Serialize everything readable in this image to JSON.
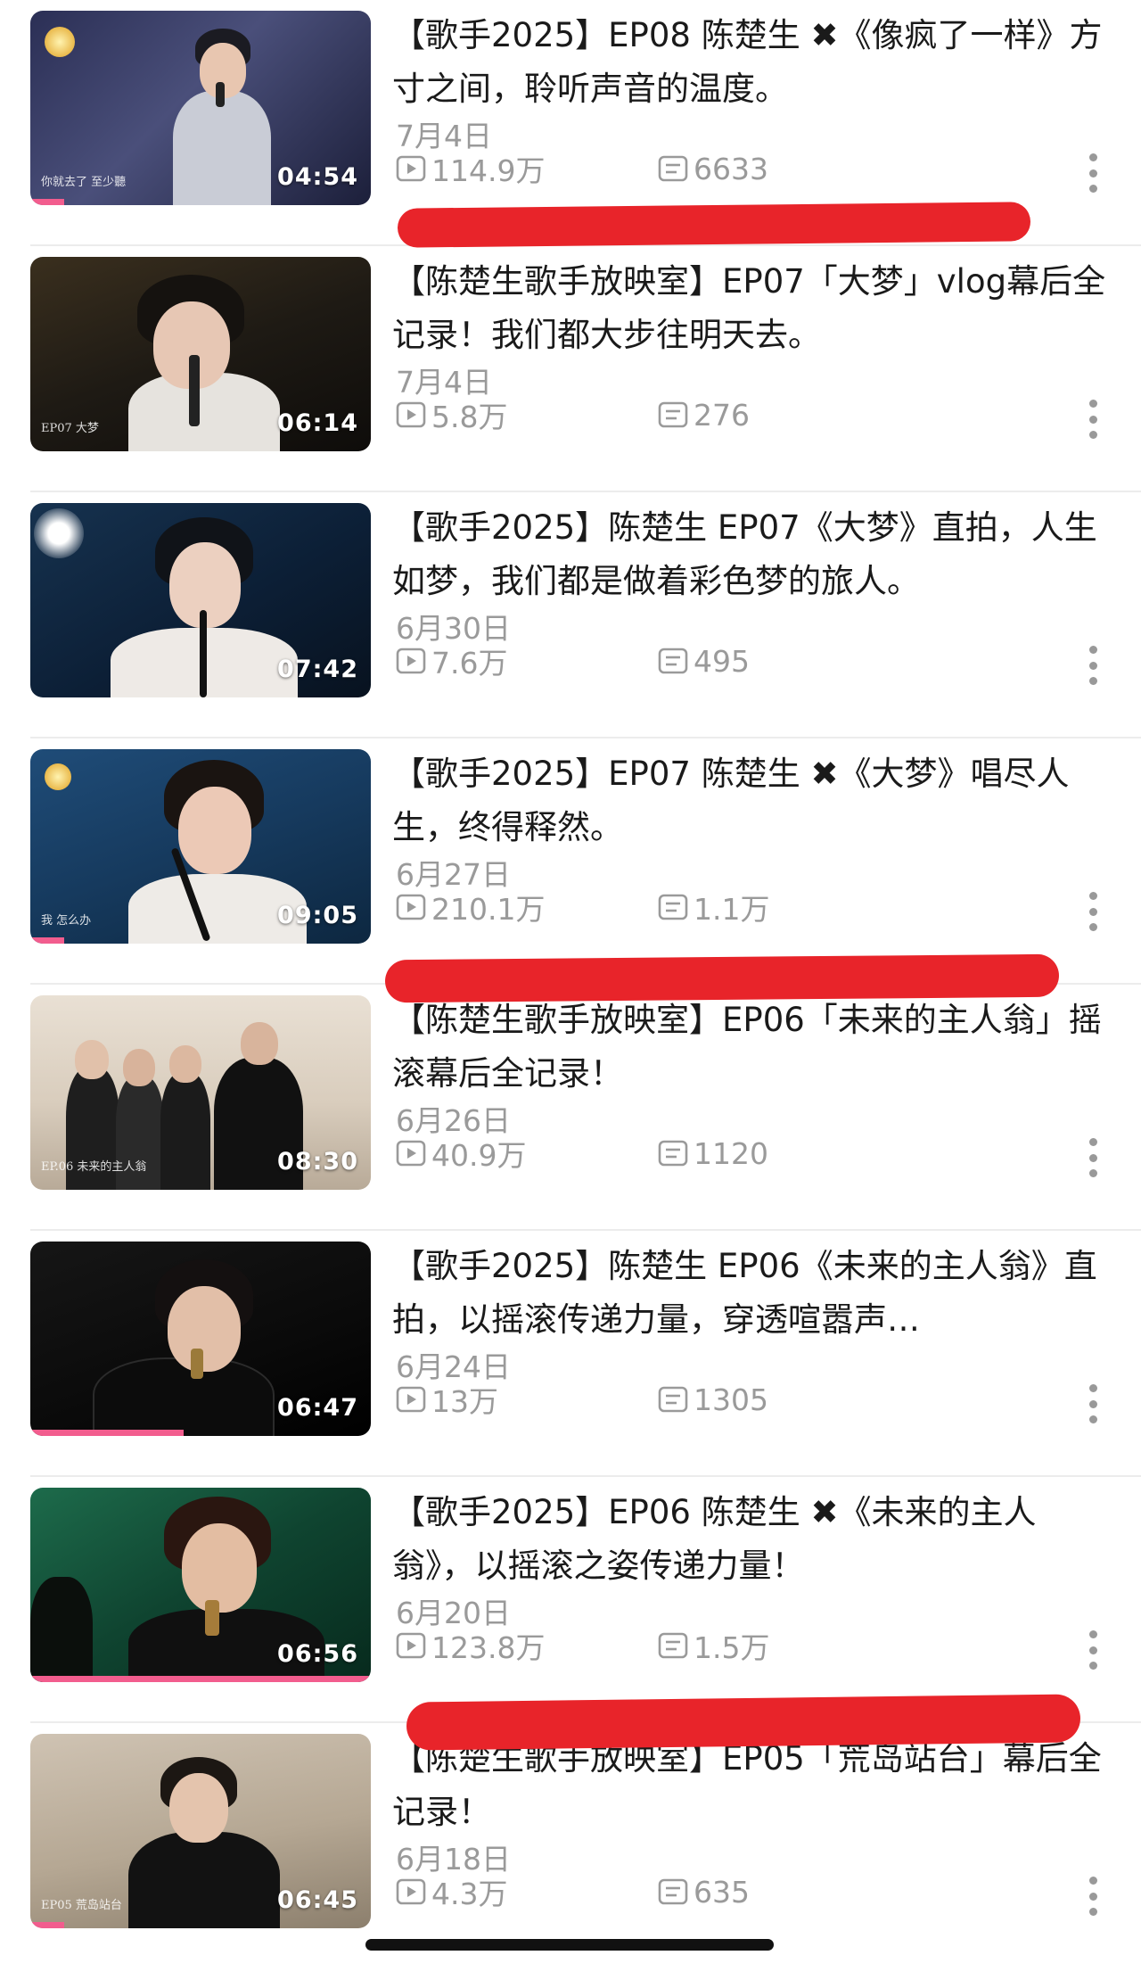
{
  "videos": [
    {
      "title": "【歌手2025】EP08 陈楚生 ✖《像疯了一样》方寸之间，聆听声音的温度。",
      "date": "7月4日",
      "views": "114.9万",
      "comments": "6633",
      "duration": "04:54",
      "watch_progress": 0.1,
      "thumb_text": "你就去了 至少聽"
    },
    {
      "title": "【陈楚生歌手放映室】EP07「大梦」vlog幕后全记录！我们都大步往明天去。",
      "date": "7月4日",
      "views": "5.8万",
      "comments": "276",
      "duration": "06:14",
      "watch_progress": 0,
      "thumb_text": "EP07 大梦"
    },
    {
      "title": "【歌手2025】陈楚生 EP07《大梦》直拍，人生如梦，我们都是做着彩色梦的旅人。",
      "date": "6月30日",
      "views": "7.6万",
      "comments": "495",
      "duration": "07:42",
      "watch_progress": 0,
      "thumb_text": ""
    },
    {
      "title": "【歌手2025】EP07 陈楚生 ✖《大梦》唱尽人生，终得释然。",
      "date": "6月27日",
      "views": "210.1万",
      "comments": "1.1万",
      "duration": "09:05",
      "watch_progress": 0.1,
      "thumb_text": "我 怎么办"
    },
    {
      "title": "【陈楚生歌手放映室】EP06「未来的主人翁」摇滚幕后全记录！",
      "date": "6月26日",
      "views": "40.9万",
      "comments": "1120",
      "duration": "08:30",
      "watch_progress": 0,
      "thumb_text": "EP.06 未来的主人翁"
    },
    {
      "title": "【歌手2025】陈楚生 EP06《未来的主人翁》直拍，以摇滚传递力量，穿透喧嚣声…",
      "date": "6月24日",
      "views": "13万",
      "comments": "1305",
      "duration": "06:47",
      "watch_progress": 0.45,
      "thumb_text": ""
    },
    {
      "title": "【歌手2025】EP06 陈楚生 ✖《未来的主人翁》，以摇滚之姿传递力量！",
      "date": "6月20日",
      "views": "123.8万",
      "comments": "1.5万",
      "duration": "06:56",
      "watch_progress": 1.0,
      "thumb_text": ""
    },
    {
      "title": "【陈楚生歌手放映室】EP05「荒岛站台」幕后全记录！",
      "date": "6月18日",
      "views": "4.3万",
      "comments": "635",
      "duration": "06:45",
      "watch_progress": 0.1,
      "thumb_text": "EP05 荒岛站台"
    }
  ],
  "icons": {
    "play": "play-count-icon",
    "comment": "comment-count-icon",
    "more": "more-vertical-icon"
  },
  "colors": {
    "accent": "#f25d8e",
    "redaction": "#e8242a",
    "meta_text": "#9a9a9a"
  }
}
